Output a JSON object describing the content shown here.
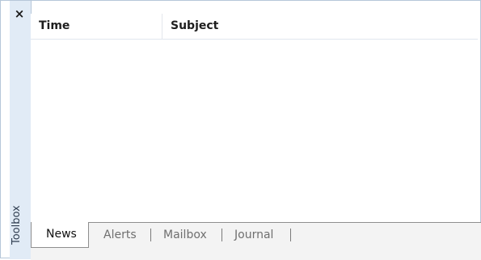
{
  "toolbox": {
    "label": "Toolbox",
    "close_glyph": "×"
  },
  "list": {
    "columns": [
      "Time",
      "Subject"
    ],
    "rows": []
  },
  "tabs": [
    {
      "label": "News",
      "active": true
    },
    {
      "label": "Alerts",
      "active": false
    },
    {
      "label": "Mailbox",
      "active": false
    },
    {
      "label": "Journal",
      "active": false
    }
  ]
}
